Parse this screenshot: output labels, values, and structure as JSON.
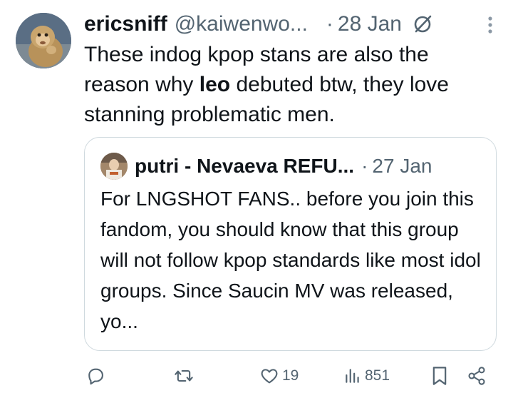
{
  "tweet": {
    "author_name": "ericsniff",
    "author_handle": "@kaiwenwo...",
    "separator": "·",
    "date": "28 Jan",
    "text_before": "These indog kpop stans are also the reason why ",
    "text_bold": "leo",
    "text_after": " debuted btw, they love stanning problematic men."
  },
  "quote": {
    "author_name": "putri - Nevaeva REFU...",
    "separator": "·",
    "date": "27 Jan",
    "text": "For LNGSHOT FANS.. before you join this fandom, you should know that this group will not follow kpop standards like most idol groups. Since Saucin MV was released, yo..."
  },
  "actions": {
    "reply_icon": "reply-icon",
    "retweet_icon": "retweet-icon",
    "like_icon": "heart-icon",
    "like_count": "19",
    "views_icon": "views-icon",
    "view_count": "851",
    "bookmark_icon": "bookmark-icon",
    "share_icon": "share-icon"
  },
  "colors": {
    "text": "#0f1419",
    "secondary": "#536471",
    "border": "#cfd9de"
  }
}
